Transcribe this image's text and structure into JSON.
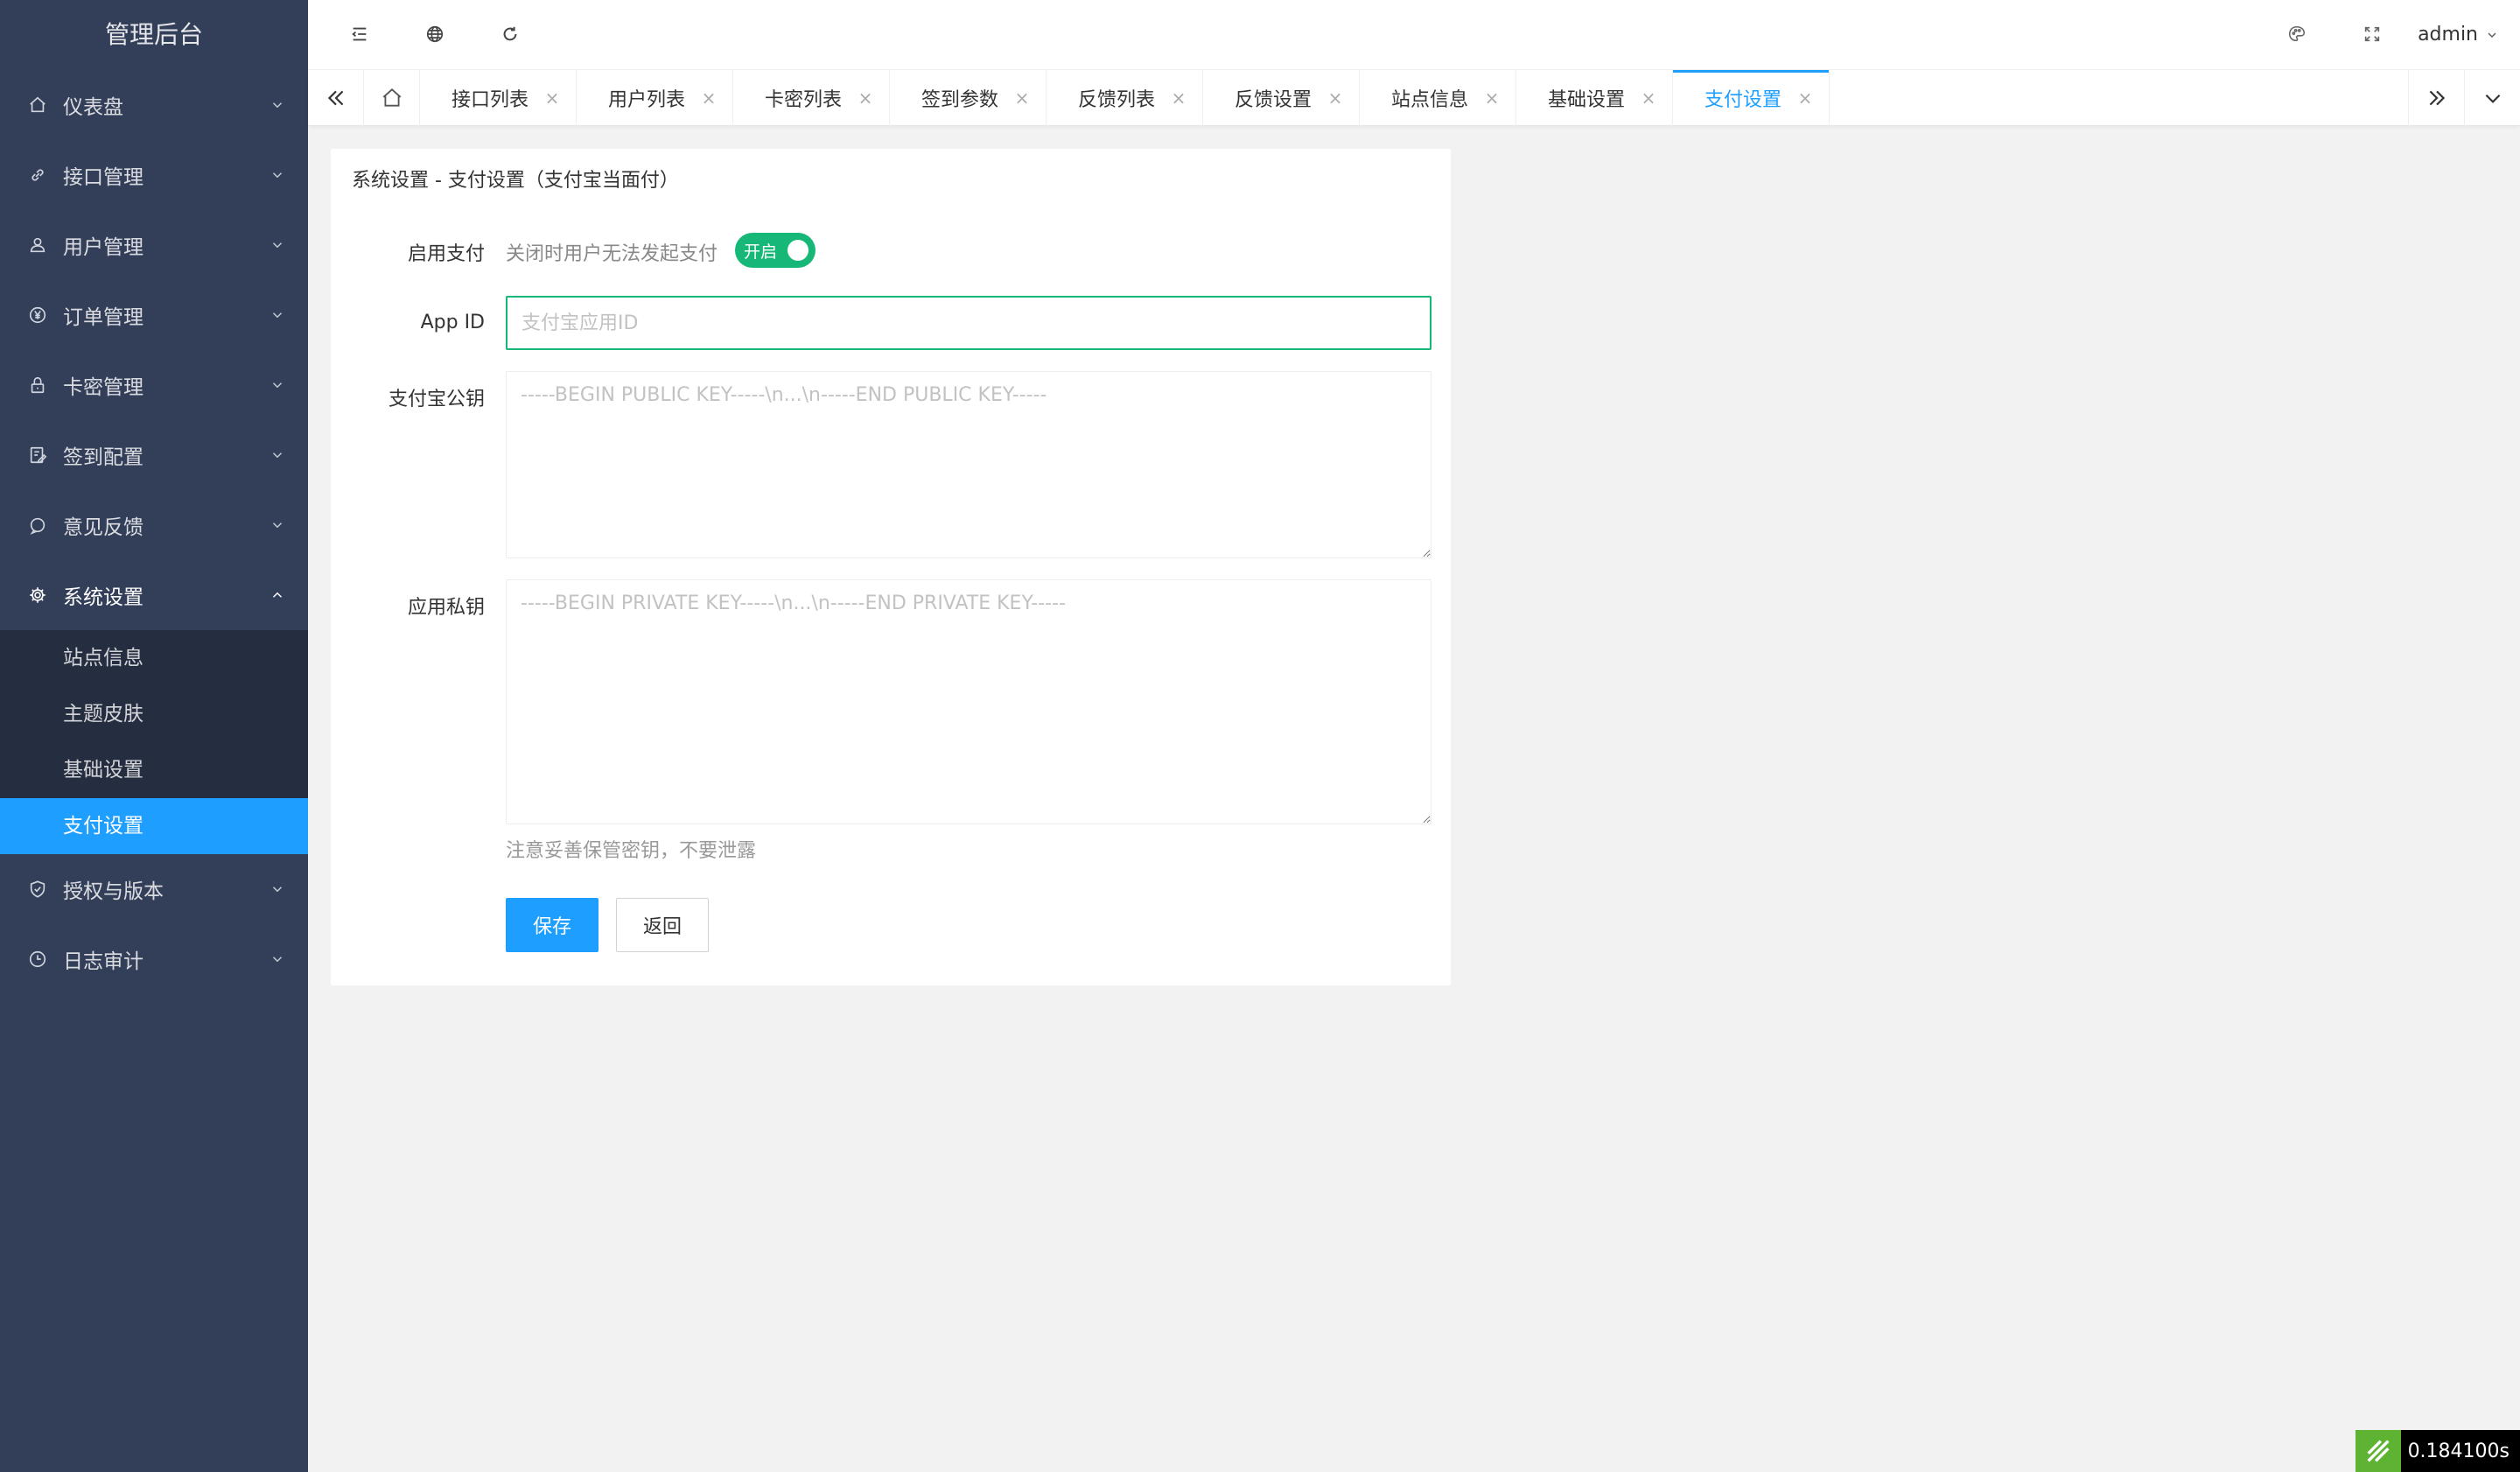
{
  "sidebar": {
    "logo": "管理后台",
    "items": [
      {
        "label": "仪表盘",
        "icon": "home-icon"
      },
      {
        "label": "接口管理",
        "icon": "link-icon"
      },
      {
        "label": "用户管理",
        "icon": "user-icon"
      },
      {
        "label": "订单管理",
        "icon": "yen-icon"
      },
      {
        "label": "卡密管理",
        "icon": "lock-icon"
      },
      {
        "label": "签到配置",
        "icon": "checkin-icon"
      },
      {
        "label": "意见反馈",
        "icon": "chat-icon"
      },
      {
        "label": "系统设置",
        "icon": "gear-icon",
        "expanded": true
      },
      {
        "label": "授权与版本",
        "icon": "shield-icon"
      },
      {
        "label": "日志审计",
        "icon": "clock-icon"
      }
    ],
    "submenu": [
      {
        "label": "站点信息"
      },
      {
        "label": "主题皮肤"
      },
      {
        "label": "基础设置"
      },
      {
        "label": "支付设置",
        "active": true
      }
    ]
  },
  "header": {
    "user": "admin",
    "icons": [
      "menu-fold-icon",
      "globe-icon",
      "refresh-icon",
      "palette-icon",
      "fullscreen-icon"
    ]
  },
  "tabs": [
    {
      "label": "接口列表"
    },
    {
      "label": "用户列表"
    },
    {
      "label": "卡密列表"
    },
    {
      "label": "签到参数"
    },
    {
      "label": "反馈列表"
    },
    {
      "label": "反馈设置"
    },
    {
      "label": "站点信息"
    },
    {
      "label": "基础设置"
    },
    {
      "label": "支付设置",
      "active": true
    }
  ],
  "form": {
    "title": "系统设置 - 支付设置（支付宝当面付）",
    "enable": {
      "label": "启用支付",
      "description": "关闭时用户无法发起支付",
      "switch_text": "开启",
      "on": true
    },
    "app_id": {
      "label": "App ID",
      "value": "",
      "placeholder": "支付宝应用ID"
    },
    "public_key": {
      "label": "支付宝公钥",
      "value": "",
      "placeholder": "-----BEGIN PUBLIC KEY-----\\n...\\n-----END PUBLIC KEY-----"
    },
    "private_key": {
      "label": "应用私钥",
      "value": "",
      "placeholder": "-----BEGIN PRIVATE KEY-----\\n...\\n-----END PRIVATE KEY-----"
    },
    "hint": "注意妥善保管密钥，不要泄露",
    "save_label": "保存",
    "back_label": "返回"
  },
  "debug": {
    "time": "0.184100s"
  },
  "colors": {
    "sidebar_bg": "#333e58",
    "submenu_bg": "#252d40",
    "accent": "#1e9fff",
    "switch_on": "#16b777"
  }
}
